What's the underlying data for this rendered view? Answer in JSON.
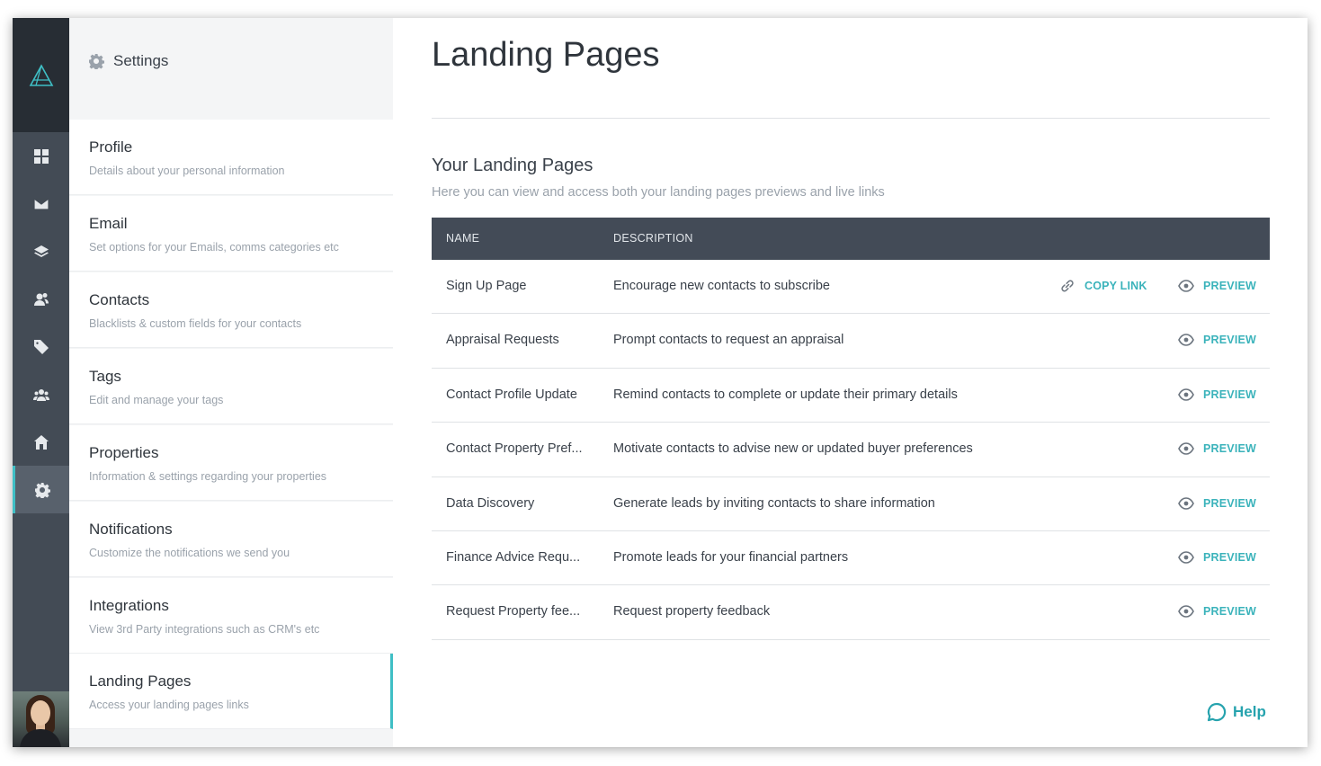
{
  "settings_header": {
    "title": "Settings",
    "icon": "gear-icon"
  },
  "rail": {
    "items": [
      {
        "icon": "dashboard-grid-icon"
      },
      {
        "icon": "envelope-icon"
      },
      {
        "icon": "layers-icon"
      },
      {
        "icon": "contacts-icon"
      },
      {
        "icon": "tag-icon"
      },
      {
        "icon": "group-icon"
      },
      {
        "icon": "home-icon"
      },
      {
        "icon": "gear-icon",
        "active": true
      }
    ]
  },
  "menu": [
    {
      "title": "Profile",
      "desc": "Details about your personal information"
    },
    {
      "title": "Email",
      "desc": "Set options for your Emails, comms categories etc"
    },
    {
      "title": "Contacts",
      "desc": "Blacklists & custom fields for your contacts"
    },
    {
      "title": "Tags",
      "desc": "Edit and manage your tags"
    },
    {
      "title": "Properties",
      "desc": "Information & settings regarding your properties"
    },
    {
      "title": "Notifications",
      "desc": "Customize the notifications we send you"
    },
    {
      "title": "Integrations",
      "desc": "View 3rd Party integrations such as CRM's etc"
    },
    {
      "title": "Landing Pages",
      "desc": "Access your landing pages links",
      "active": true
    }
  ],
  "main": {
    "title": "Landing Pages",
    "section_title": "Your Landing Pages",
    "section_sub": "Here you can view and access both your landing pages previews and live links",
    "table": {
      "headers": {
        "name": "NAME",
        "description": "DESCRIPTION"
      },
      "copy_label": "COPY LINK",
      "preview_label": "PREVIEW",
      "rows": [
        {
          "name": "Sign Up Page",
          "desc": "Encourage new contacts to subscribe",
          "copy": true
        },
        {
          "name": "Appraisal Requests",
          "desc": "Prompt contacts to request an appraisal"
        },
        {
          "name": "Contact Profile Update",
          "desc": "Remind contacts to complete or update their primary details"
        },
        {
          "name": "Contact Property Pref...",
          "desc": "Motivate contacts to advise new or updated buyer preferences"
        },
        {
          "name": "Data Discovery",
          "desc": "Generate leads by inviting contacts to share information"
        },
        {
          "name": "Finance Advice Requ...",
          "desc": "Promote leads for your financial partners"
        },
        {
          "name": "Request Property fee...",
          "desc": "Request property feedback"
        }
      ]
    }
  },
  "help_label": "Help",
  "colors": {
    "accent": "#3fbfc5",
    "rail": "#434b55",
    "rail_dark": "#272d34",
    "table_header": "#434b57"
  }
}
